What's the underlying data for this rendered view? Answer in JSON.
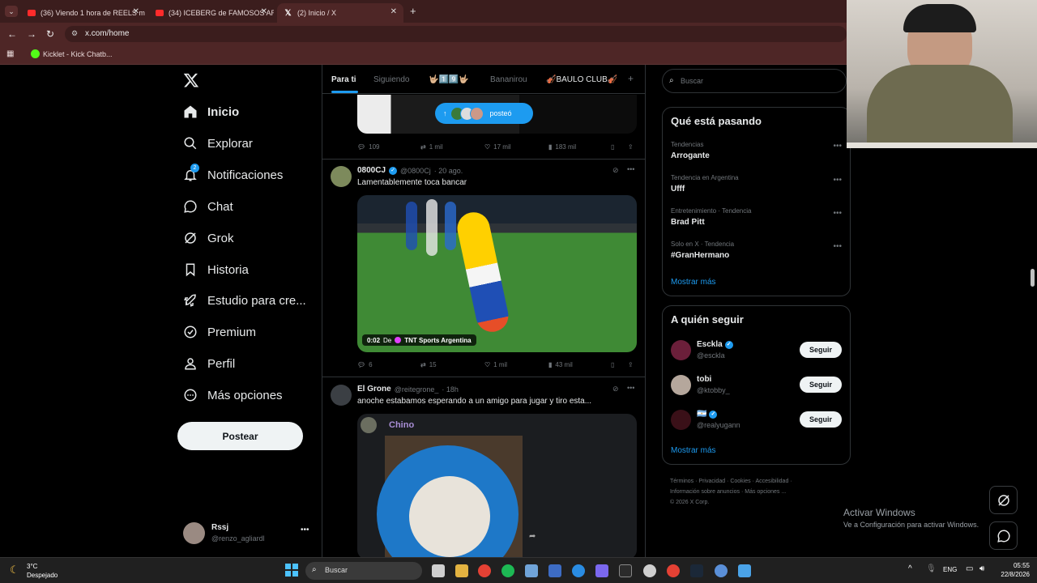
{
  "browser": {
    "tabs": [
      {
        "title": "(36) Viendo 1 hora de REELS m",
        "icon": "youtube-icon"
      },
      {
        "title": "(34) ICEBERG de FAMOSOS ARG",
        "icon": "youtube-icon"
      },
      {
        "title": "(2) Inicio / X",
        "icon": "x-icon",
        "active": true
      }
    ],
    "url": "x.com/home",
    "bookmark": "Kicklet - Kick Chatb..."
  },
  "sidebar": {
    "items": [
      {
        "label": "Inicio",
        "icon": "home-icon"
      },
      {
        "label": "Explorar",
        "icon": "search-icon"
      },
      {
        "label": "Notificaciones",
        "icon": "bell-icon",
        "badge": "2"
      },
      {
        "label": "Chat",
        "icon": "chat-icon"
      },
      {
        "label": "Grok",
        "icon": "grok-icon"
      },
      {
        "label": "Historia",
        "icon": "bookmark-icon"
      },
      {
        "label": "Estudio para cre...",
        "icon": "rocket-icon"
      },
      {
        "label": "Premium",
        "icon": "verified-icon"
      },
      {
        "label": "Perfil",
        "icon": "person-icon"
      },
      {
        "label": "Más opciones",
        "icon": "more-circle-icon"
      }
    ],
    "post_button": "Postear",
    "account": {
      "name": "Rssj௃",
      "handle": "@renzo_agliardl"
    }
  },
  "feed": {
    "tabs": [
      "Para ti",
      "Siguiendo",
      "🤟🏼1️⃣9️⃣🤟🏼",
      "Bananirou",
      "🎻BAULO CLUB🎻",
      "+"
    ],
    "new_posts_pill": "posteó",
    "posts": [
      {
        "stats": [
          "109",
          "1 mil",
          "17 mil",
          "183 mil"
        ]
      },
      {
        "name": "0800CJ",
        "handle": "@0800Cj",
        "time": "· 20 ago.",
        "text": "Lamentablemente toca bancar",
        "video_time": "0:02",
        "video_source_prefix": "De",
        "video_source": "TNT Sports Argentina",
        "stats": [
          "6",
          "15",
          "1 mil",
          "43 mil"
        ]
      },
      {
        "name": "El Grone",
        "handle": "@reitegrone_",
        "time": "· 18h",
        "text": "anoche estabamos esperando a un amigo para jugar y tiro esta...",
        "image_caption": "Chino"
      }
    ]
  },
  "right": {
    "search_placeholder": "Buscar",
    "trends_title": "Qué está pasando",
    "trends": [
      {
        "context": "Tendencias",
        "topic": "Arrogante"
      },
      {
        "context": "Tendencia en Argentina",
        "topic": "Ufff"
      },
      {
        "context": "Entretenimiento · Tendencia",
        "topic": "Brad Pitt"
      },
      {
        "context": "Solo en X · Tendencia",
        "topic": "#GranHermano"
      }
    ],
    "show_more": "Mostrar más",
    "follow_title": "A quién seguir",
    "follow": [
      {
        "name": "Esckla",
        "handle": "@esckla",
        "button": "Seguir"
      },
      {
        "name": "tobi",
        "handle": "@ktobby_",
        "button": "Seguir"
      },
      {
        "name": "🇦🇷",
        "handle": "@realyugann",
        "button": "Seguir"
      }
    ],
    "footer_line1": [
      "Términos",
      "Privacidad",
      "Cookies",
      "Accesibilidad"
    ],
    "footer_line2": [
      "Información sobre anuncios",
      "Más opciones ..."
    ],
    "copyright": "© 2026 X Corp."
  },
  "watermark": {
    "title": "Activar Windows",
    "subtitle": "Ve a Configuración para activar Windows."
  },
  "taskbar": {
    "weather_temp": "3°C",
    "weather_desc": "Despejado",
    "search": "Buscar",
    "lang": "ENG",
    "time": "05:55",
    "date": "22/8/2026"
  },
  "colors": {
    "accent": "#1d9bf0",
    "chrome": "#4e2626",
    "background": "#000000"
  }
}
